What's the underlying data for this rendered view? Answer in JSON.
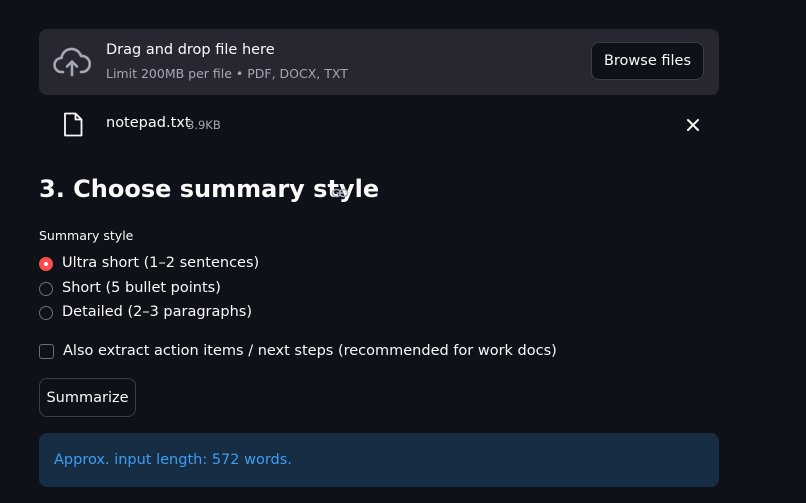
{
  "uploader": {
    "title": "Drag and drop file here",
    "limit": "Limit 200MB per file • PDF, DOCX, TXT",
    "browse_label": "Browse files",
    "icon": "cloud-upload-icon"
  },
  "file": {
    "name": "notepad.txt",
    "size": "3.9KB",
    "icon": "file-icon",
    "remove_icon": "close-icon"
  },
  "section": {
    "title": "3. Choose summary style",
    "anchor_icon": "link-icon"
  },
  "summary_style": {
    "label": "Summary style",
    "options": [
      {
        "label": "Ultra short (1–2 sentences)",
        "selected": true
      },
      {
        "label": "Short (5 bullet points)",
        "selected": false
      },
      {
        "label": "Detailed (2–3 paragraphs)",
        "selected": false
      }
    ]
  },
  "action_items": {
    "label": "Also extract action items / next steps (recommended for work docs)",
    "checked": false
  },
  "summarize_button": {
    "label": "Summarize"
  },
  "info": {
    "text": "Approx. input length: 572 words."
  },
  "colors": {
    "background": "#0e1117",
    "accent": "#ff4b4b",
    "info_bg": "#172d43",
    "info_text": "#3d9df3"
  }
}
